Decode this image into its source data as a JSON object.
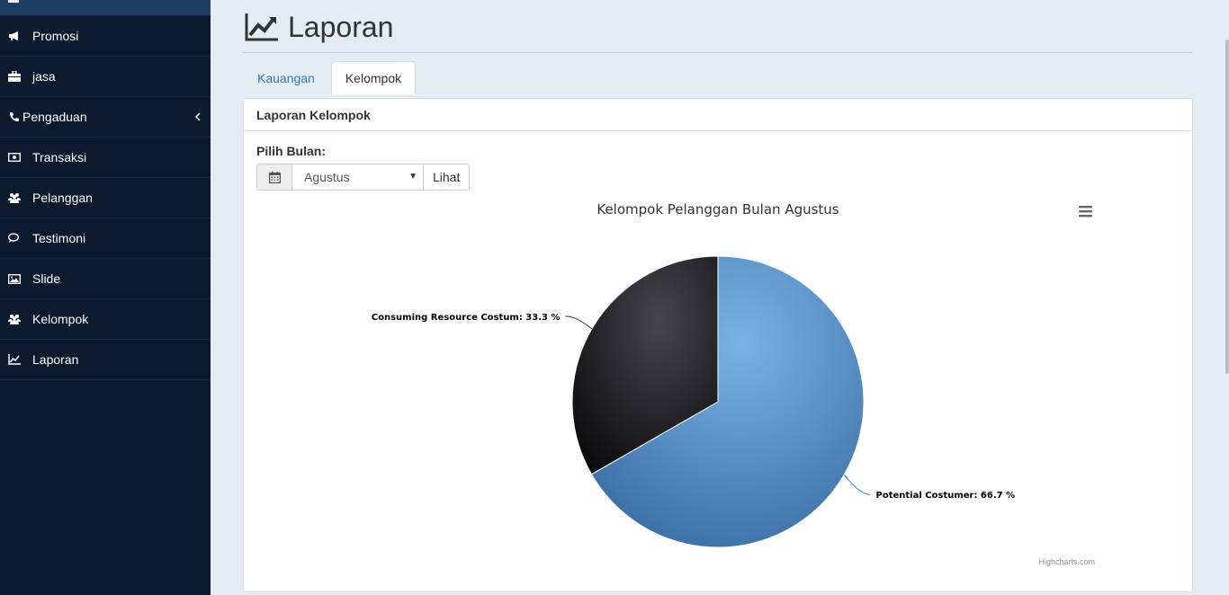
{
  "sidebar": {
    "items": [
      {
        "label": "Promosi",
        "icon": "bullhorn-icon"
      },
      {
        "label": "jasa",
        "icon": "briefcase-icon"
      },
      {
        "label": "Pengaduan",
        "icon": "phone-icon"
      },
      {
        "label": "Transaksi",
        "icon": "money-icon"
      },
      {
        "label": "Pelanggan",
        "icon": "users-icon"
      },
      {
        "label": "Testimoni",
        "icon": "comments-icon"
      },
      {
        "label": "Slide",
        "icon": "image-icon"
      },
      {
        "label": "Kelompok",
        "icon": "users-icon"
      },
      {
        "label": "Laporan",
        "icon": "line-chart-icon"
      }
    ]
  },
  "header": {
    "title": "Laporan"
  },
  "tabs": [
    {
      "label": "Kauangan",
      "active": false
    },
    {
      "label": "Kelompok",
      "active": true
    }
  ],
  "panel": {
    "heading": "Laporan Kelompok",
    "form_label": "Pilih Bulan:",
    "month_selected": "Agustus",
    "submit_label": "Lihat"
  },
  "colors": {
    "sidebar_bg": "#0b1a2d",
    "series_blue": "#4f89c4",
    "series_dark": "#232327",
    "link": "#337ab7"
  },
  "chart_data": {
    "type": "pie",
    "title": "Kelompok Pelanggan Bulan Agustus",
    "credits": "Highcharts.com",
    "menu_icon": "hamburger-menu-icon",
    "slices": [
      {
        "name": "Potential Costumer",
        "value": 66.7,
        "label": "Potential Costumer: 66.7 %",
        "color": "#4f89c4"
      },
      {
        "name": "Consuming Resource Costum",
        "value": 33.3,
        "label": "Consuming Resource Costum: 33.3 %",
        "color": "#232327"
      }
    ]
  }
}
